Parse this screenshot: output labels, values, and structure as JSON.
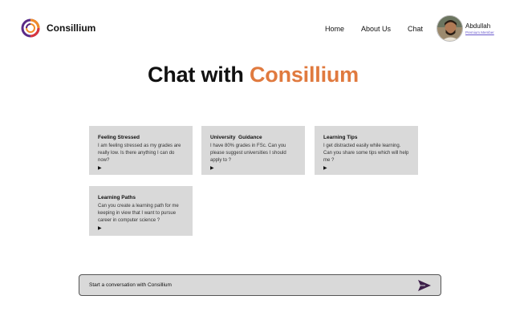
{
  "brand": {
    "name": "Consillium",
    "logo_icon": "ring-logo-icon",
    "colors": {
      "accent": "#e07a3f",
      "ring_orange": "#f28c28",
      "ring_purple": "#5b2a86",
      "ring_red": "#d9363e"
    }
  },
  "nav": {
    "items": [
      {
        "label": "Home"
      },
      {
        "label": "About Us"
      },
      {
        "label": "Chat"
      }
    ]
  },
  "user": {
    "name": "Abdullah",
    "tier": "Premium Member",
    "avatar_icon": "user-avatar-icon"
  },
  "hero": {
    "title_prefix": "Chat with ",
    "title_accent": "Consillium"
  },
  "prompts": [
    {
      "title": "Feeling Stressed",
      "text": "I am feeling stressed as my grades are really low. Is there anything I can do now?",
      "icon": "play-icon"
    },
    {
      "title": "University  Guidance",
      "text": "I have 80% grades in FSc. Can you please suggest universities I should apply to ?",
      "icon": "play-icon"
    },
    {
      "title": "Learning Tips",
      "text": "I get distracted easily while learning. Can you share some tips which will help me ?",
      "icon": "play-icon"
    },
    {
      "title": "Learning Paths",
      "text": "Can you create a learning path for me keeping in view that I want to pursue career in computer science ?",
      "icon": "play-icon"
    }
  ],
  "chat_input": {
    "placeholder": "Start a conversation with Consillium",
    "value": "",
    "send_icon": "send-icon"
  }
}
